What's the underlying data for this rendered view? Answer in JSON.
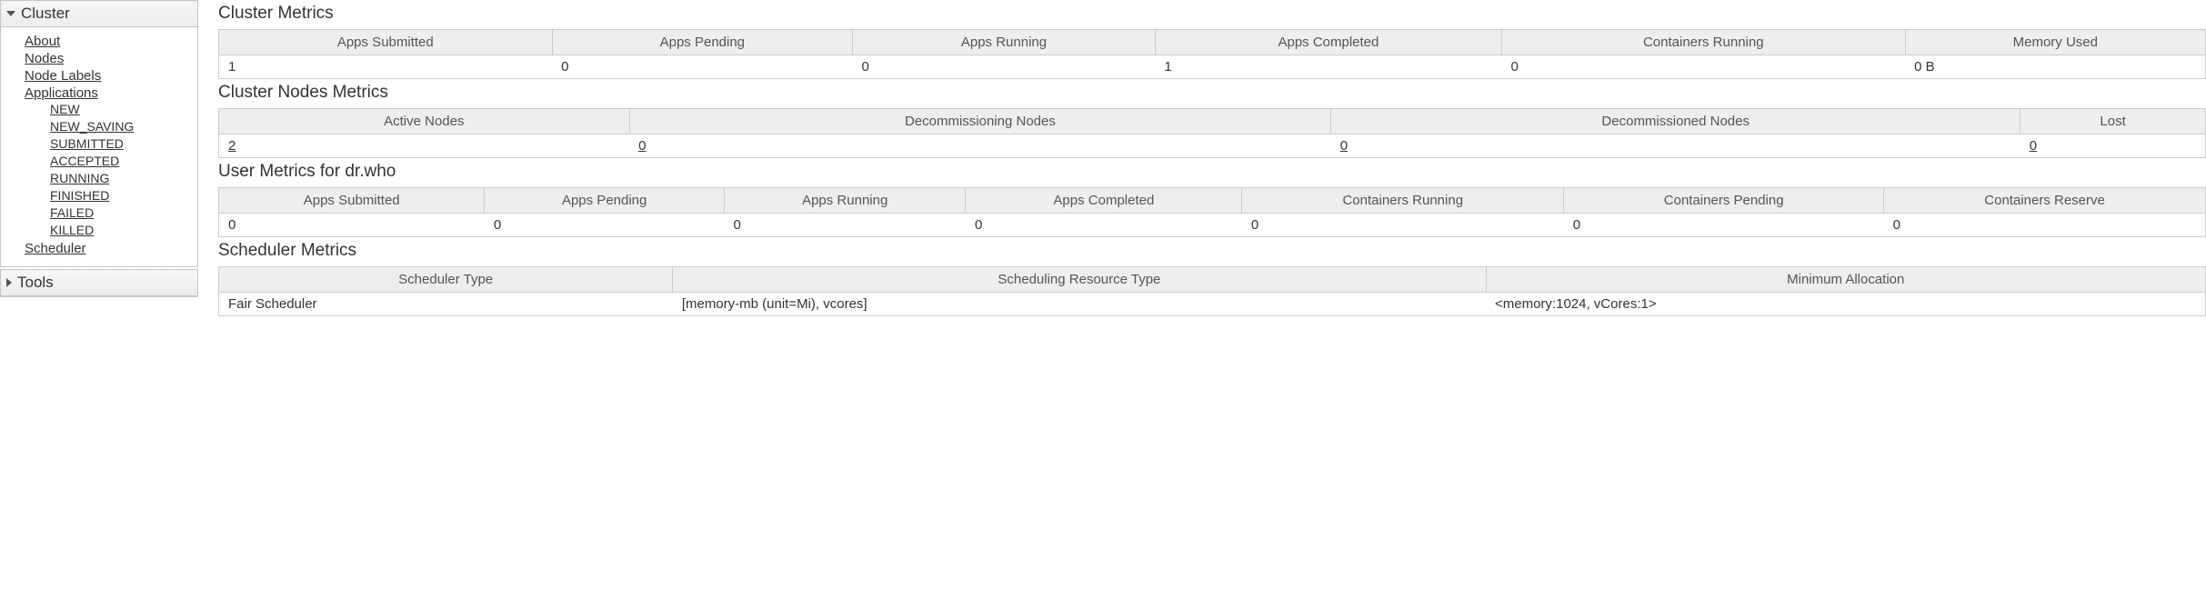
{
  "sidebar": {
    "cluster": {
      "title": "Cluster",
      "links": {
        "about": "About",
        "nodes": "Nodes",
        "node_labels": "Node Labels",
        "applications": "Applications",
        "scheduler": "Scheduler"
      },
      "app_states": [
        "NEW",
        "NEW_SAVING",
        "SUBMITTED",
        "ACCEPTED",
        "RUNNING",
        "FINISHED",
        "FAILED",
        "KILLED"
      ]
    },
    "tools": {
      "title": "Tools"
    }
  },
  "sections": {
    "cluster_metrics": {
      "title": "Cluster Metrics",
      "headers": [
        "Apps Submitted",
        "Apps Pending",
        "Apps Running",
        "Apps Completed",
        "Containers Running",
        "Memory Used"
      ],
      "values": [
        "1",
        "0",
        "0",
        "1",
        "0",
        "0 B"
      ]
    },
    "cluster_nodes_metrics": {
      "title": "Cluster Nodes Metrics",
      "headers": [
        "Active Nodes",
        "Decommissioning Nodes",
        "Decommissioned Nodes",
        "Lost"
      ],
      "values": [
        "2",
        "0",
        "0",
        "0"
      ]
    },
    "user_metrics": {
      "title": "User Metrics for dr.who",
      "headers": [
        "Apps Submitted",
        "Apps Pending",
        "Apps Running",
        "Apps Completed",
        "Containers Running",
        "Containers Pending",
        "Containers Reserve"
      ],
      "values": [
        "0",
        "0",
        "0",
        "0",
        "0",
        "0",
        "0"
      ]
    },
    "scheduler_metrics": {
      "title": "Scheduler Metrics",
      "headers": [
        "Scheduler Type",
        "Scheduling Resource Type",
        "Minimum Allocation"
      ],
      "values": [
        "Fair Scheduler",
        "[memory-mb (unit=Mi), vcores]",
        "<memory:1024, vCores:1>"
      ]
    }
  }
}
